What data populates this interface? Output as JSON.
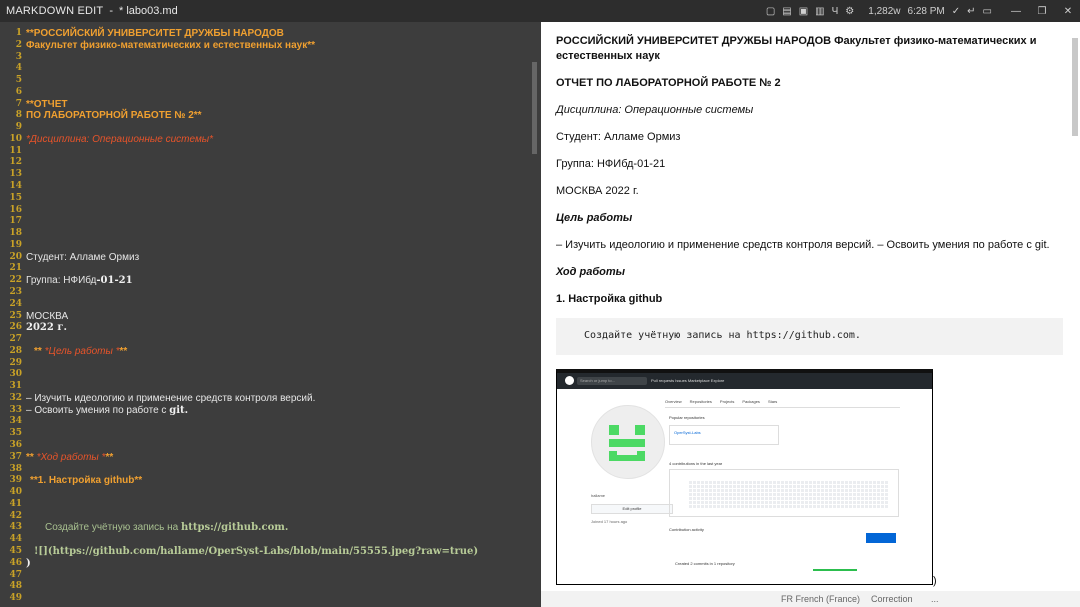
{
  "titlebar": {
    "app": "MARKDOWN EDIT",
    "separator": "-",
    "file": "* labo03.md",
    "word_count": "1,282w",
    "time": "6:28 PM"
  },
  "editor": {
    "lines": {
      "l1": "**РОССИЙСКИЙ УНИВЕРСИТЕТ ДРУЖБЫ НАРОДОВ",
      "l2": "Факультет физико-математических и естественных наук**",
      "l7": "**ОТЧЕТ",
      "l8": "ПО ЛАБОРАТОРНОЙ РАБОТЕ № 2**",
      "l10": "*Дисциплина: Операционные системы*",
      "l20a": "Студент",
      "l20b": ": Алламе Ормиз",
      "l22a": "Группа",
      "l22b": ": НФИбд",
      "l22c": "-01-21",
      "l25": "МОСКВА",
      "l26": "2022 г.",
      "l28a": "** ",
      "l28b": "*Цель работы *",
      "l28c": "**",
      "l32": "– Изучить идеологию и применение средств контроля версий.",
      "l33a": "– Освоить умения по работе с ",
      "l33b": "git.",
      "l37a": "** ",
      "l37b": "*Ход работы *",
      "l37c": "**",
      "l39": "**1.  Настройка github**",
      "l43a": "Создайте учётную запись на ",
      "l43b": "https://github.com.",
      "l45": "![](https://github.com/hallame/OperSyst-Labs/blob/main/55555.jpeg?raw=true)",
      "l46": ")"
    }
  },
  "preview": {
    "title": "РОССИЙСКИЙ УНИВЕРСИТЕТ ДРУЖБЫ НАРОДОВ Факультет физико-математических и",
    "title2": "естественных наук",
    "report": "ОТЧЕТ ПО ЛАБОРАТОРНОЙ РАБОТЕ № 2",
    "discipline": "Дисциплина: Операционные системы",
    "student": "Студент: Алламе Ормиз",
    "group": "Группа: НФИбд-01-21",
    "city_year": "МОСКВА 2022 г.",
    "goal_heading": "Цель работы",
    "goal_text": "– Изучить идеологию и применение средств контроля версий. – Освоить умения по работе с git.",
    "progress_heading": "Ход работы",
    "step1": "1. Настройка github",
    "code_text": "Создайте учётную запись на https://github.com.",
    "after_image": ")",
    "screenshot": {
      "search": "Search or jump to...",
      "nav": "Pull requests   Issues   Marketplace   Explore",
      "tabs": [
        "Overview",
        "Repositories",
        "Projects",
        "Packages",
        "Stars"
      ],
      "popular": "Popular repositories",
      "repo": "OperSyst-Labs",
      "contributions": "4 contributions in the last year",
      "activity": "Contribution activity",
      "edit_profile": "Edit profile",
      "name": "hallame",
      "joined": "Joined 17 hours ago",
      "activity_item": "Created 2 commits in 1 repository"
    }
  },
  "statusbar": {
    "language": "FR French (France)",
    "correction": "Correction",
    "dots": "..."
  }
}
